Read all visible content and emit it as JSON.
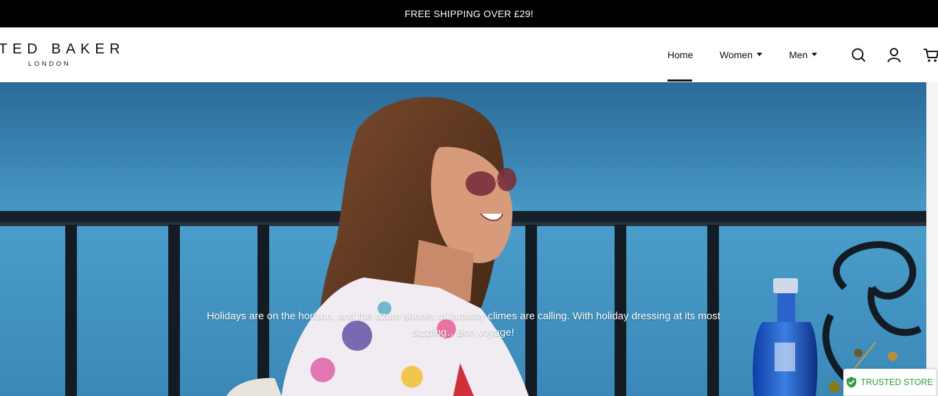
{
  "announcement": {
    "text": "FREE SHIPPING OVER £29!"
  },
  "header": {
    "logo_main": "TED BAKER",
    "logo_sub": "LONDON",
    "nav": [
      {
        "label": "Home",
        "active": true
      },
      {
        "label": "Women",
        "has_dropdown": true
      },
      {
        "label": "Men",
        "has_dropdown": true
      }
    ],
    "icons": [
      "search-icon",
      "account-icon",
      "cart-icon"
    ]
  },
  "hero": {
    "caption": "Holidays are on the horizon, and the azure shores of faraway climes are calling. With holiday dressing at its most sizzling…Bon voyage!"
  },
  "badge": {
    "label": "TRUSTED STORE",
    "icon": "shield-check-icon",
    "color": "#2e9e3c"
  },
  "colors": {
    "announcement_bg": "#000000",
    "text": "#111111"
  }
}
